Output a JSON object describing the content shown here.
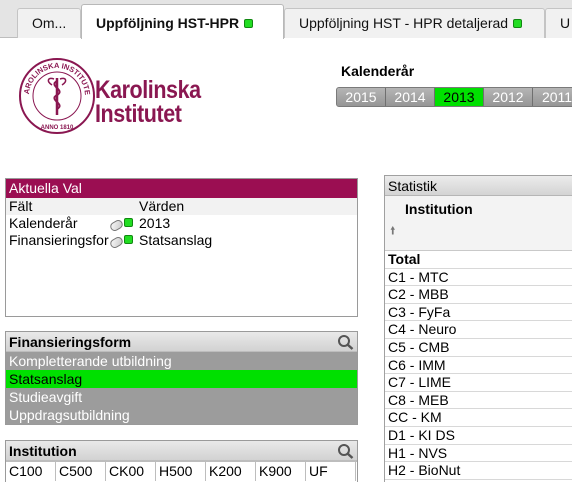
{
  "tabs": [
    {
      "label": "Om...",
      "led": false,
      "active": false
    },
    {
      "label": "Uppföljning HST-HPR",
      "led": true,
      "active": true
    },
    {
      "label": "Uppföljning HST - HPR detaljerad",
      "led": true,
      "active": false
    },
    {
      "label": "U",
      "led": false,
      "active": false
    }
  ],
  "logo": {
    "line1": "Karolinska",
    "line2": "Institutet",
    "seal_ring": "KAROLINSKA INSTITUTET",
    "seal_year": "ANNO 1810"
  },
  "calendar": {
    "title": "Kalenderår",
    "years": [
      "2015",
      "2014",
      "2013",
      "2012",
      "2011"
    ],
    "selected": "2013"
  },
  "aktuella": {
    "title": "Aktuella Val",
    "col_field": "Fält",
    "col_value": "Värden",
    "rows": [
      {
        "field": "Kalenderår",
        "value": "2013"
      },
      {
        "field": "Finansieringsform",
        "value": "Statsanslag"
      }
    ]
  },
  "finansiering": {
    "title": "Finansieringsform",
    "items": [
      "Kompletterande utbildning",
      "Statsanslag",
      "Studieavgift",
      "Uppdragsutbildning"
    ],
    "selected": "Statsanslag"
  },
  "institution_list": {
    "title": "Institution",
    "cells": [
      "C100",
      "C500",
      "CK00",
      "H500",
      "K200",
      "K900",
      "UF"
    ]
  },
  "statistik": {
    "title": "Statistik",
    "column_header": "Institution",
    "rows": [
      "Total",
      "C1 - MTC",
      "C2 - MBB",
      "C3 - FyFa",
      "C4 - Neuro",
      "C5 - CMB",
      "C6 - IMM",
      "C7 - LIME",
      "C8 - MEB",
      "CC - KM",
      "D1 - KI DS",
      "H1 - NVS",
      "H2 - BioNut"
    ]
  },
  "colors": {
    "accent": "#9b0e52",
    "selected": "#00e000",
    "brand": "#8a1751"
  }
}
